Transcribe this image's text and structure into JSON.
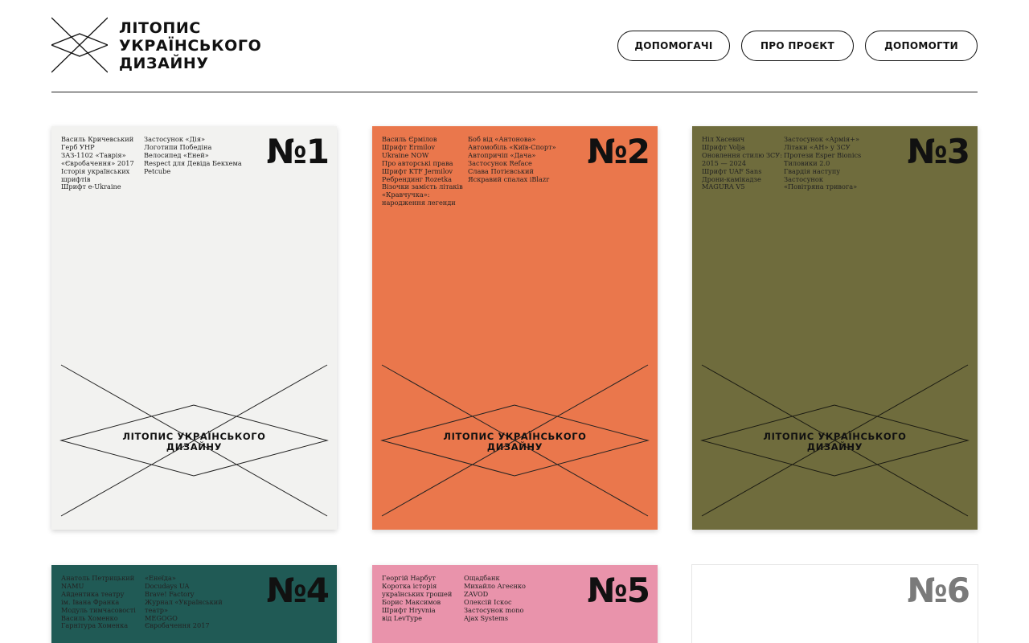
{
  "header": {
    "logo_lines": [
      "ЛІТОПИС",
      "УКРАЇНСЬКОГО",
      "ДИЗАЙНУ"
    ],
    "nav": [
      "ДОПОМОГАЧІ",
      "ПРО ПРОЄКТ",
      "ДОПОМОГТИ"
    ]
  },
  "cover_title_lines": [
    "ЛІТОПИС УКРАЇНСЬКОГО",
    "ДИЗАЙНУ"
  ],
  "books": [
    {
      "number": "№1",
      "color": "#f2f2f0",
      "col_a": [
        "Василь Кричевський",
        "Герб УНР",
        "ЗАЗ-1102 «Таврія»",
        "«Євробачення» 2017",
        "Історія українських",
        "шрифтів",
        "Шрифт e-Ukraine"
      ],
      "col_b": [
        "Застосунок «Дія»",
        "Логотипи Победіна",
        "Велосипед «Еней»",
        "Respect для Девіда Бекхема",
        "Petcube"
      ]
    },
    {
      "number": "№2",
      "color": "#ea774c",
      "col_a": [
        "Василь Єрмілов",
        "Шрифт Ermilov",
        "Ukraine NOW",
        "Про авторські права",
        "Шрифт KTF Jermilov",
        "Ребрендинг Rozetka",
        "Візочки замість літаків",
        "«Кравчучка»:",
        "народження легенди"
      ],
      "col_b": [
        "Боб від «Антонова»",
        "Автомобіль «Київ-Спорт»",
        "Автопричіп «Дача»",
        "Застосунок Reface",
        "Слава Потієвський",
        "Яскравий спалах iBlazr"
      ]
    },
    {
      "number": "№3",
      "color": "#6f6c3d",
      "col_a": [
        "Ніл Хасевич",
        "Шрифт Volja",
        "Оновлення стилю ЗСУ:",
        "2015 — 2024",
        "Шрифт UAF Sans",
        "Дрони-камікадзе",
        "MAGURA V5"
      ],
      "col_b": [
        "Застосунок «Армія+»",
        "Літаки «АН» у ЗСУ",
        "Протези Esper Bionics",
        "Тиловики 2.0",
        "Гвардія наступу",
        "Застосунок",
        "«Повітряна тривога»"
      ]
    },
    {
      "number": "№4",
      "color": "#205a55",
      "col_a": [
        "Анатоль Петрицький",
        "NAMU",
        "Айдентика театру",
        "ім. Івана Франка",
        "Модуль тимчасовості",
        "Василь Хоменко",
        "Гарнітура Хоменка"
      ],
      "col_b": [
        "«Енеїда»",
        "Docudays UA",
        "Brave! Factory",
        "Журнал «Український",
        "театр»",
        "MEGOGO",
        "Євробачення 2017"
      ]
    },
    {
      "number": "№5",
      "color": "#e993ab",
      "col_a": [
        "Георгій Нарбут",
        "Коротка історія",
        "українських грошей",
        "Борис Максимов",
        "Шрифт Hryvnia",
        "від LevType"
      ],
      "col_b": [
        "Ощадбанк",
        "Михайло Агеєнко",
        "ZAVOD",
        "Олексій Іскос",
        "Застосунок mono",
        "Ajax Systems"
      ]
    },
    {
      "number": "№6",
      "color": "#ffffff",
      "col_a": [],
      "col_b": []
    }
  ]
}
